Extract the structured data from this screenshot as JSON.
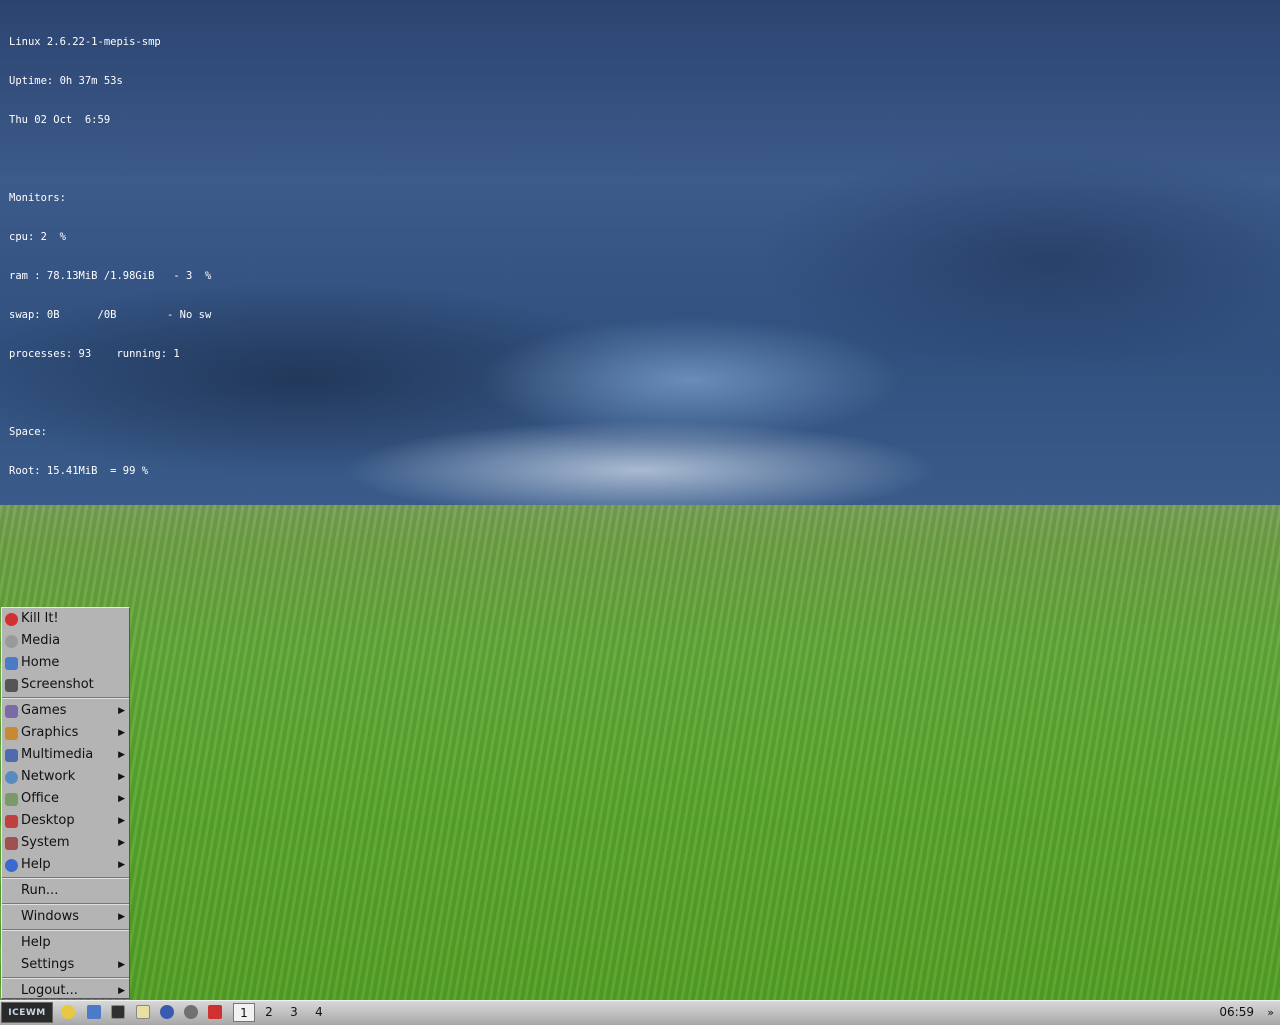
{
  "sysmon": {
    "lines": [
      "Linux 2.6.22-1-mepis-smp",
      "Uptime: 0h 37m 53s",
      "Thu 02 Oct  6:59",
      "",
      "Monitors:",
      "cpu: 2  %",
      "ram : 78.13MiB /1.98GiB   - 3  %",
      "swap: 0B      /0B        - No sw",
      "processes: 93    running: 1",
      "",
      "Space:",
      "Root: 15.41MiB  = 99 %"
    ]
  },
  "menu": {
    "items": [
      {
        "label": "Kill It!",
        "icon": "kill-icon",
        "color": "#d03030",
        "submenu": false
      },
      {
        "label": "Media",
        "icon": "media-icon",
        "color": "#9a9a9a",
        "submenu": false
      },
      {
        "label": "Home",
        "icon": "home-icon",
        "color": "#4a7ac8",
        "submenu": false
      },
      {
        "label": "Screenshot",
        "icon": "screenshot-icon",
        "color": "#555555",
        "submenu": false
      },
      {
        "label": "Games",
        "icon": "games-icon",
        "color": "#7a6aa8",
        "submenu": true
      },
      {
        "label": "Graphics",
        "icon": "graphics-icon",
        "color": "#c88a30",
        "submenu": true
      },
      {
        "label": "Multimedia",
        "icon": "multimedia-icon",
        "color": "#506ab0",
        "submenu": true
      },
      {
        "label": "Network",
        "icon": "network-icon",
        "color": "#5a8ac0",
        "submenu": true
      },
      {
        "label": "Office",
        "icon": "office-icon",
        "color": "#7a9a6a",
        "submenu": true
      },
      {
        "label": "Desktop",
        "icon": "desktop-icon",
        "color": "#c04040",
        "submenu": true
      },
      {
        "label": "System",
        "icon": "system-icon",
        "color": "#a05050",
        "submenu": true
      },
      {
        "label": "Help",
        "icon": "help-icon",
        "color": "#3a6ad0",
        "submenu": true
      },
      {
        "label": "Run...",
        "submenu": false
      },
      {
        "label": "Windows",
        "submenu": true
      },
      {
        "label": "Help",
        "submenu": false
      },
      {
        "label": "Settings",
        "submenu": true
      },
      {
        "label": "Logout...",
        "submenu": true
      }
    ]
  },
  "taskbar": {
    "start_label": "ICEWM",
    "quick_launch": [
      {
        "icon": "folder-icon",
        "color": "#e8c840"
      },
      {
        "icon": "file-manager-icon",
        "color": "#4a7ac8"
      },
      {
        "icon": "terminal-icon",
        "color": "#303030"
      },
      {
        "icon": "editor-icon",
        "color": "#e8e0a0"
      },
      {
        "icon": "browser-icon",
        "color": "#3a5ab0"
      },
      {
        "icon": "settings-icon",
        "color": "#707070"
      },
      {
        "icon": "shutdown-icon",
        "color": "#d03030"
      }
    ],
    "workspaces": [
      "1",
      "2",
      "3",
      "4"
    ],
    "active_workspace": "1",
    "clock": "06:59",
    "tray_arrow": "»"
  }
}
